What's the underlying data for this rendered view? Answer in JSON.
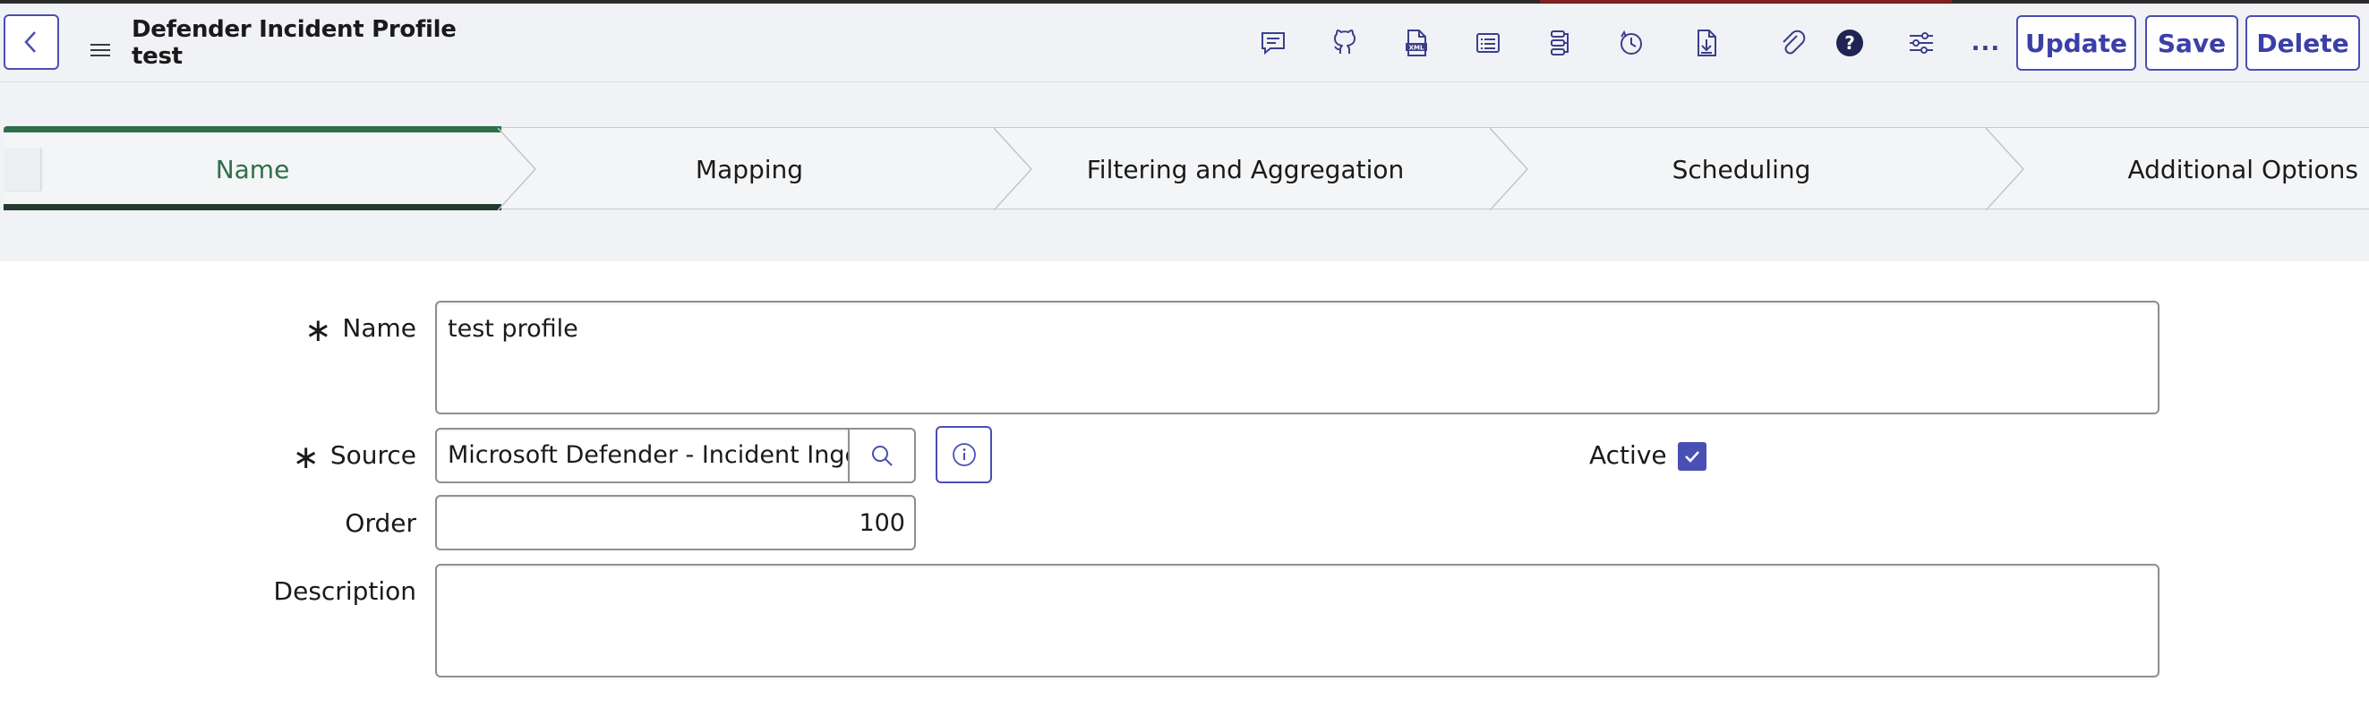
{
  "header": {
    "title_line1": "Defender Incident Profile",
    "title_line2": "test",
    "icons": [
      "comment-icon",
      "github-icon",
      "xml-icon",
      "list-icon",
      "workflow-icon",
      "history-icon",
      "download-file-icon",
      "attachment-icon",
      "help-icon",
      "settings-sliders-icon",
      "more-icon"
    ],
    "more_label": "...",
    "update_label": "Update",
    "save_label": "Save",
    "delete_label": "Delete"
  },
  "tabs": [
    {
      "label": "Name",
      "active": true
    },
    {
      "label": "Mapping",
      "active": false
    },
    {
      "label": "Filtering and Aggregation",
      "active": false
    },
    {
      "label": "Scheduling",
      "active": false
    },
    {
      "label": "Additional Options",
      "active": false
    }
  ],
  "form": {
    "name": {
      "label": "Name",
      "required": true,
      "value": "test profile"
    },
    "source": {
      "label": "Source",
      "required": true,
      "value": "Microsoft Defender - Incident Ingestion"
    },
    "active": {
      "label": "Active",
      "checked": true
    },
    "order": {
      "label": "Order",
      "value": "100"
    },
    "description": {
      "label": "Description",
      "value": ""
    },
    "required_marker": "∗"
  },
  "colors": {
    "accent": "#4a4fb3",
    "active_tab": "#2e6f49",
    "header_bg": "#f1f2f5"
  }
}
